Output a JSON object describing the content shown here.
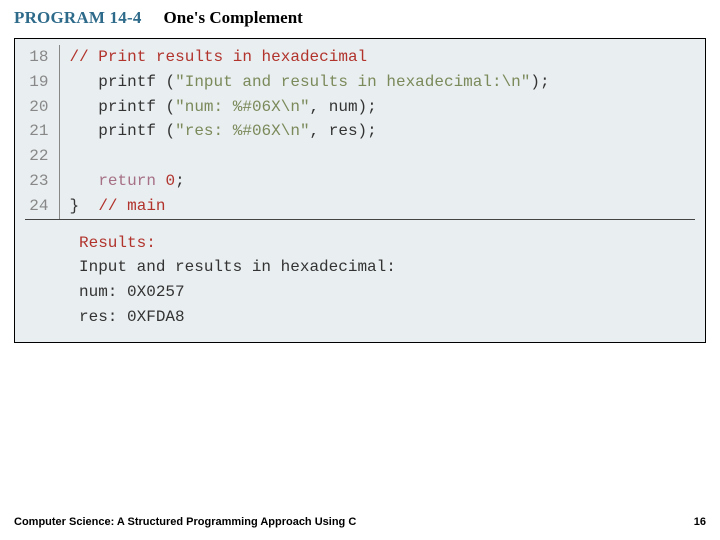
{
  "header": {
    "program_label": "PROGRAM 14-4",
    "program_title": "One's Complement"
  },
  "code": {
    "lines": [
      {
        "n": "18",
        "segments": [
          {
            "cls": "cmt",
            "text": "// Print results in hexadecimal"
          }
        ]
      },
      {
        "n": "19",
        "segments": [
          {
            "cls": "",
            "text": "   printf "
          },
          {
            "cls": "punct",
            "text": "("
          },
          {
            "cls": "str",
            "text": "\"Input and results in hexadecimal:\\n\""
          },
          {
            "cls": "punct",
            "text": ");"
          }
        ]
      },
      {
        "n": "20",
        "segments": [
          {
            "cls": "",
            "text": "   printf "
          },
          {
            "cls": "punct",
            "text": "("
          },
          {
            "cls": "str",
            "text": "\"num: %#06X\\n\""
          },
          {
            "cls": "punct",
            "text": ", num);"
          }
        ]
      },
      {
        "n": "21",
        "segments": [
          {
            "cls": "",
            "text": "   printf "
          },
          {
            "cls": "punct",
            "text": "("
          },
          {
            "cls": "str",
            "text": "\"res: %#06X\\n\""
          },
          {
            "cls": "punct",
            "text": ", res);"
          }
        ]
      },
      {
        "n": "22",
        "segments": [
          {
            "cls": "",
            "text": " "
          }
        ]
      },
      {
        "n": "23",
        "segments": [
          {
            "cls": "",
            "text": "   "
          },
          {
            "cls": "kw",
            "text": "return"
          },
          {
            "cls": "",
            "text": " "
          },
          {
            "cls": "num",
            "text": "0"
          },
          {
            "cls": "punct",
            "text": ";"
          }
        ]
      },
      {
        "n": "24",
        "segments": [
          {
            "cls": "punct",
            "text": "}"
          },
          {
            "cls": "",
            "text": "  "
          },
          {
            "cls": "cmt",
            "text": "// main"
          }
        ]
      }
    ]
  },
  "results": {
    "label": "Results:",
    "body": "Input and results in hexadecimal:\nnum: 0X0257\nres: 0XFDA8"
  },
  "footer": {
    "left": "Computer Science: A Structured Programming Approach Using C",
    "page": "16"
  }
}
